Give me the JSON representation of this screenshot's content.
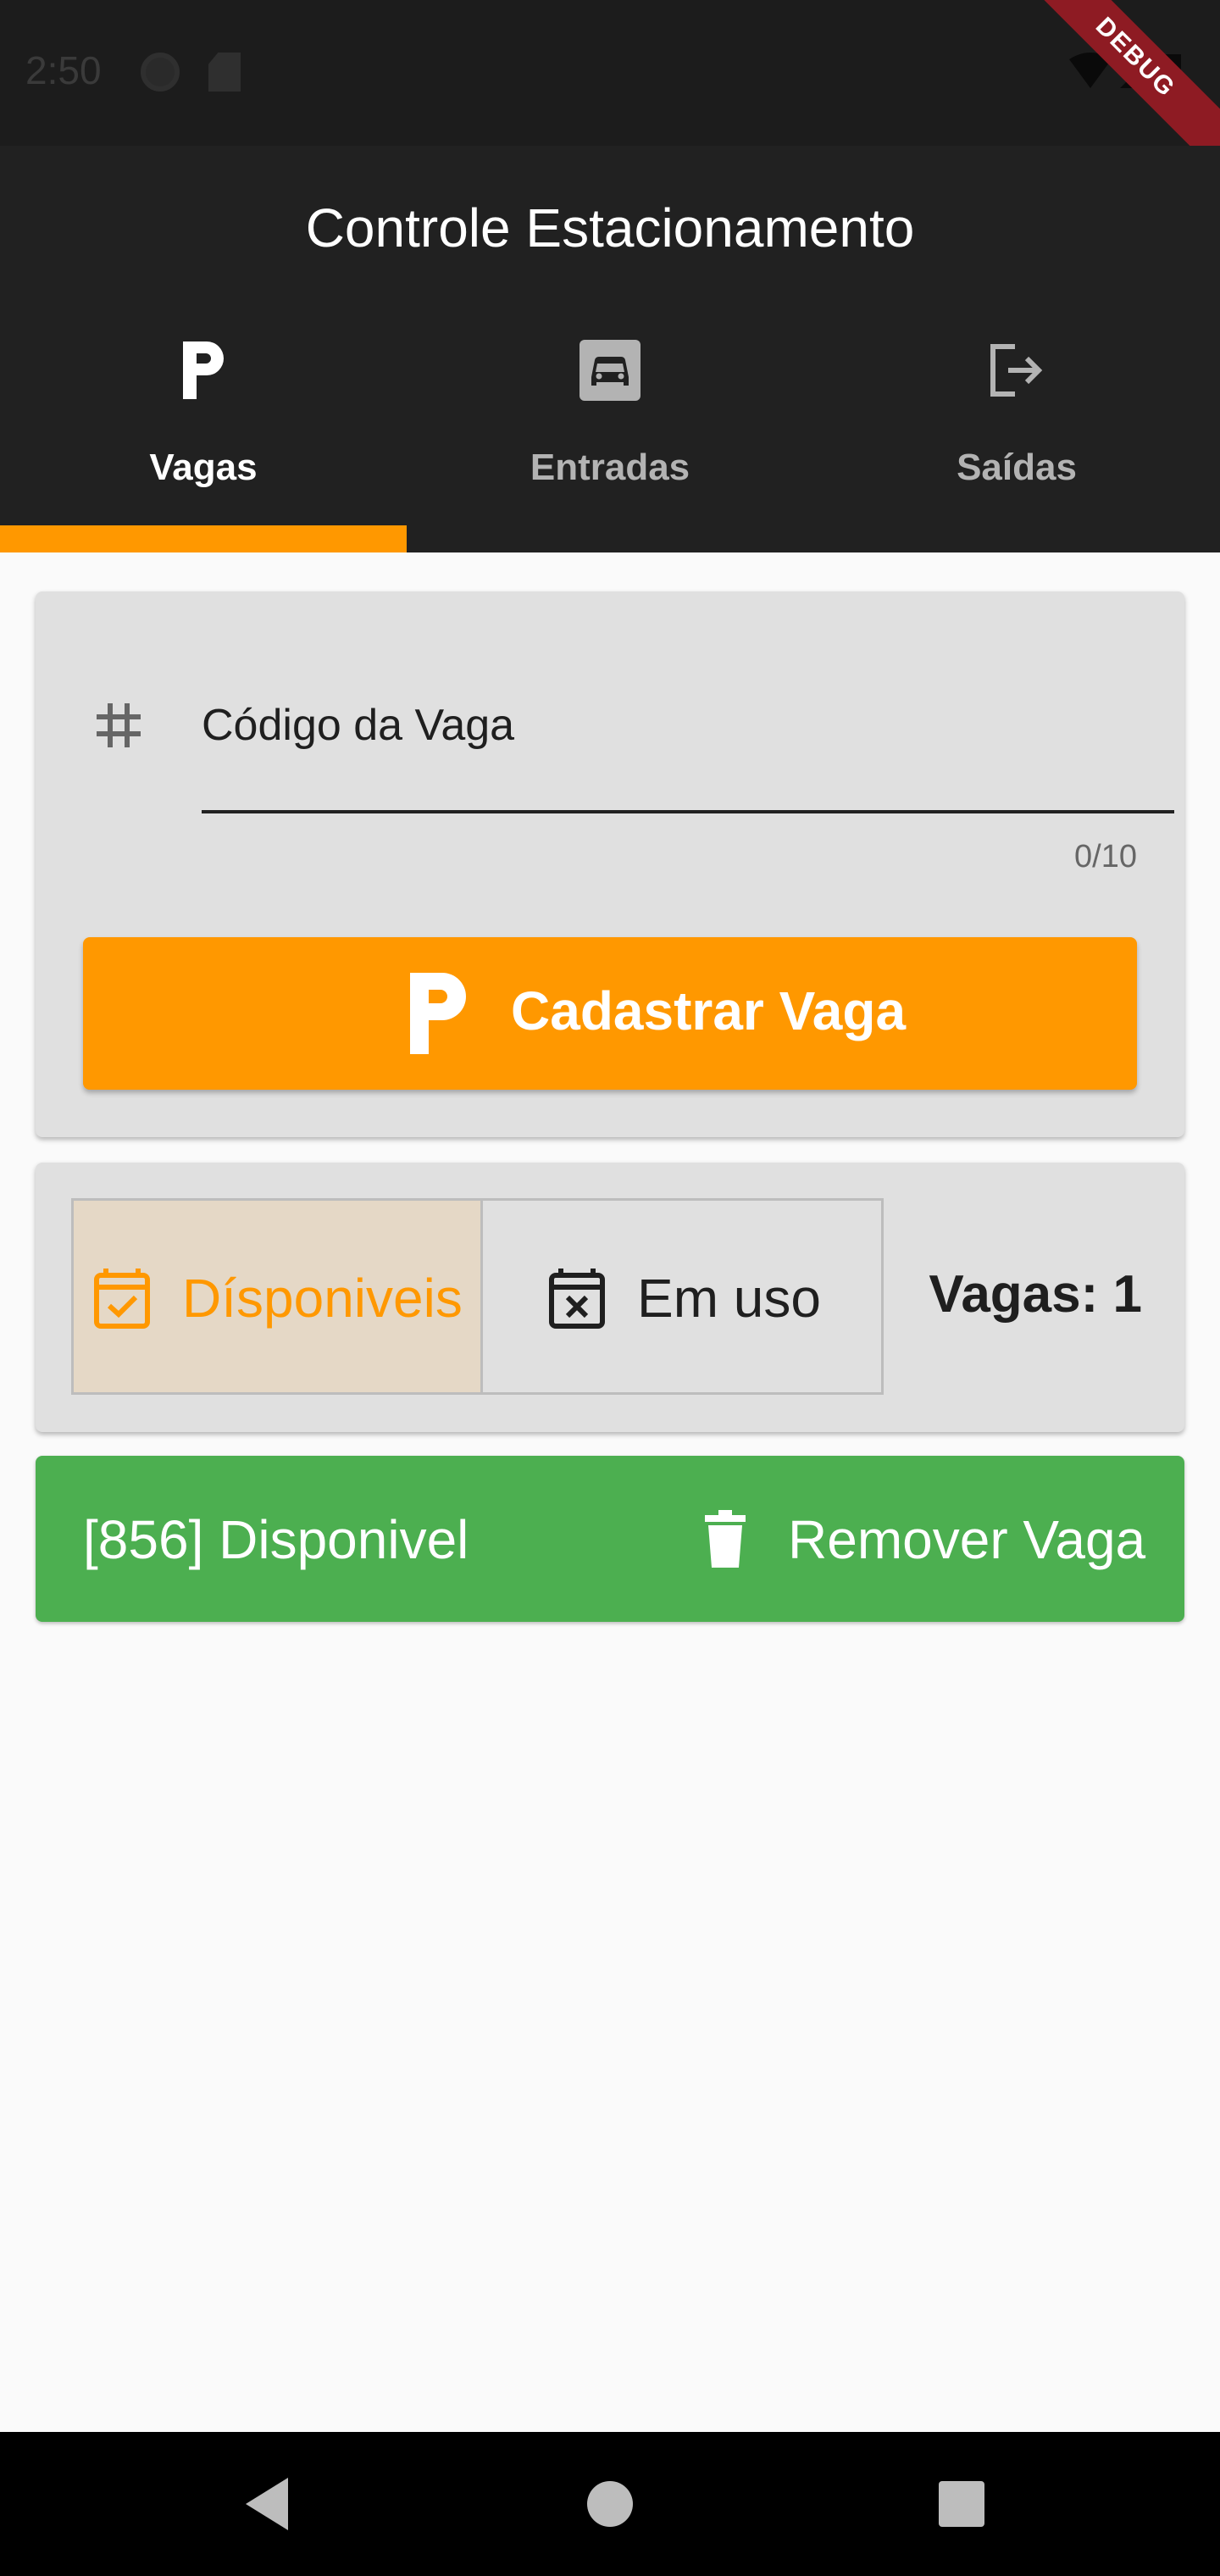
{
  "status_bar": {
    "time": "2:50",
    "debug_label": "DEBUG"
  },
  "app": {
    "title": "Controle Estacionamento"
  },
  "tabs": [
    {
      "label": "Vagas",
      "icon": "parking-p-icon",
      "active": true
    },
    {
      "label": "Entradas",
      "icon": "car-icon",
      "active": false
    },
    {
      "label": "Saídas",
      "icon": "logout-icon",
      "active": false
    }
  ],
  "form": {
    "field_label": "Código da Vaga",
    "field_value": "",
    "counter": "0/10",
    "submit_label": "Cadastrar Vaga"
  },
  "filter": {
    "available_label": "Dísponiveis",
    "in_use_label": "Em uso",
    "selected": "available",
    "count_text": "Vagas: 1"
  },
  "spots": [
    {
      "text": "[856] Disponivel",
      "remove_label": "Remover Vaga"
    }
  ],
  "colors": {
    "accent": "#ff9800",
    "app_bar": "#212121",
    "available_spot": "#4caf50",
    "selected_toggle_bg": "#e5d8c6"
  }
}
